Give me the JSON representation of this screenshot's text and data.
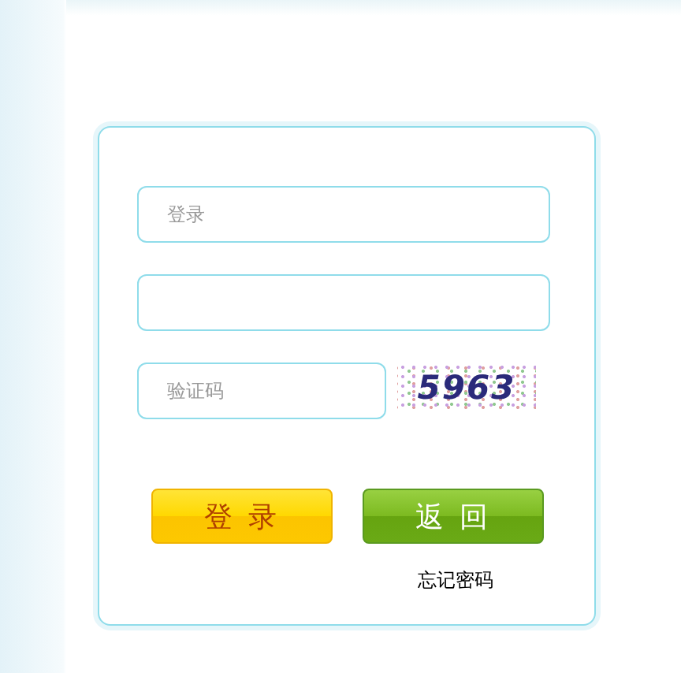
{
  "login_form": {
    "fields": [
      {
        "kind": "text",
        "placeholder": "登录"
      },
      {
        "kind": "password"
      }
    ],
    "captcha": {
      "placeholder": "验证码",
      "code": "5963"
    },
    "buttons": [
      {
        "label": "登 录",
        "kind": "primary"
      },
      {
        "label": "返 回",
        "kind": "secondary"
      }
    ],
    "forgot_link": "忘记密码"
  }
}
